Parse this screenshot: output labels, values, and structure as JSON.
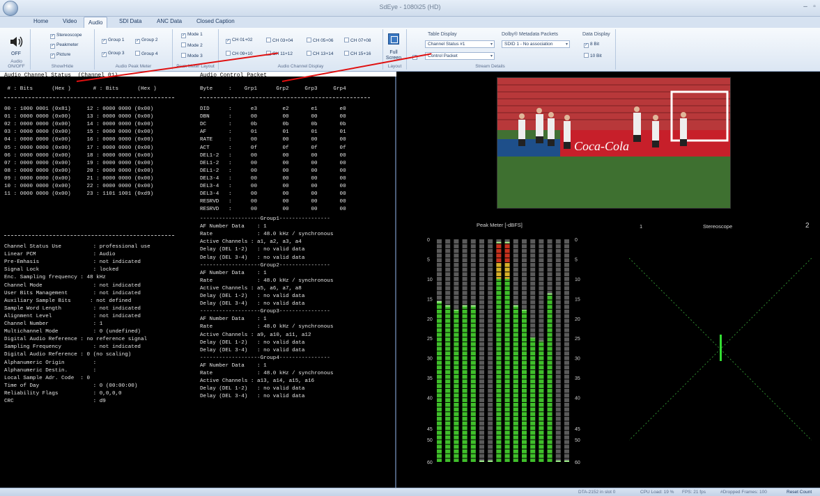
{
  "window": {
    "title": "SdEye - 1080i25  (HD)"
  },
  "tabs": [
    "Home",
    "Video",
    "Audio",
    "SDI Data",
    "ANC Data",
    "Closed Caption"
  ],
  "ribbon": {
    "audio_onoff": {
      "state": "OFF",
      "label": "Audio ON/OFF"
    },
    "show_hide": {
      "label": "Show/Hide",
      "items": [
        "Stereoscope",
        "Peakmeter",
        "Picture"
      ]
    },
    "peak_meter": {
      "label": "Audio Peak Meter",
      "items": [
        "Group 1",
        "Group 2",
        "Group 3",
        "Group 4"
      ]
    },
    "peak_layout": {
      "label": "Peak Meter Layout",
      "items": [
        "Mode 1",
        "Mode 2",
        "Mode 3"
      ]
    },
    "channel_display": {
      "label": "Audio Channel Display",
      "items": [
        "CH 01+02",
        "CH 03+04",
        "CH 05+06",
        "CH 07+08",
        "CH 09+10",
        "CH 11+12",
        "CH 13+14",
        "CH 15+16"
      ]
    },
    "layout": {
      "label": "Layout",
      "full": "Full",
      "screen": "Screen"
    },
    "table_display": {
      "header": "Table Display",
      "select1": "Channel Status #1",
      "select2": "Control Packet"
    },
    "dolby": {
      "header": "Dolby® Metadata Packets",
      "select": "SDID 1 - No association"
    },
    "stream_details": "Stream Details",
    "data_display": {
      "header": "Data Display",
      "items": [
        "8 Bit",
        "10 Bit"
      ]
    }
  },
  "left_header": {
    "status_title": "Audio Channel Status  (Channel 01)",
    "control_title": "Audio Control Packet"
  },
  "cs_header": " # : Bits      (Hex )       # : Bits      (Hex )",
  "cs_rows": [
    "00 : 1000 0001 (0x81)     12 : 0000 0000 (0x00)",
    "01 : 0000 0000 (0x00)     13 : 0000 0000 (0x00)",
    "02 : 0000 0000 (0x00)     14 : 0000 0000 (0x00)",
    "03 : 0000 0000 (0x00)     15 : 0000 0000 (0x00)",
    "04 : 0000 0000 (0x00)     16 : 0000 0000 (0x00)",
    "05 : 0000 0000 (0x00)     17 : 0000 0000 (0x00)",
    "06 : 0000 0000 (0x00)     18 : 0000 0000 (0x00)",
    "07 : 0000 0000 (0x00)     19 : 0000 0000 (0x00)",
    "08 : 0000 0000 (0x00)     20 : 0000 0000 (0x00)",
    "09 : 0000 0000 (0x00)     21 : 0000 0000 (0x00)",
    "10 : 0000 0000 (0x00)     22 : 0000 0000 (0x00)",
    "11 : 0000 0000 (0x00)     23 : 1101 1001 (0xd9)"
  ],
  "cs_info": [
    "Channel Status Use          : professional use",
    "Linear PCM                  : Audio",
    "Pre-Emhasis                 : not indicated",
    "Signal Lock                 : locked",
    "Enc. Sampling frequency : 48 kHz",
    "Channel Mode                : not indicated",
    "User Bits Management        : not indicated",
    "Auxiliary Sample Bits      : not defined",
    "Sample Word Length          : not indicated",
    "Alignment Level             : not indicated",
    "Channel Number              : 1",
    "Multichannel Mode           : 0 (undefined)",
    "Digital Audio Reference : no reference signal",
    "Sampling Frequency          : not indicated",
    "Digital Audio Reference : 0 (no scaling)",
    "Alphanumeric Origin         :",
    "Alphanumeric Destin.        :",
    "Local Sample Adr. Code  : 0",
    "Time of Day                 : 0 (00:00:00)",
    "Reliability Flags           : 0,0,0,0",
    "CRC                         : d9"
  ],
  "acp_header": "Byte     :    Grp1      Grp2     Grp3     Grp4",
  "acp_rows": [
    "DID      :      e3        e2       e1       e0",
    "DBN      :      00        00       00       00",
    "DC       :      0b        0b       0b       0b",
    "AF       :      01        01       01       01",
    "RATE     :      00        00       00       00",
    "ACT      :      0f        0f       0f       0f",
    "DEL1-2   :      00        00       00       00",
    "DEL1-2   :      00        00       00       00",
    "DEL1-2   :      00        00       00       00",
    "DEL3-4   :      00        00       00       00",
    "DEL3-4   :      00        00       00       00",
    "DEL3-4   :      00        00       00       00",
    "RESRVD   :      00        00       00       00",
    "RESRVD   :      00        00       00       00"
  ],
  "acp_groups": [
    "-------------------Group1----------------",
    "AF Number Data    : 1",
    "Rate              : 48.0 kHz / synchronous",
    "Active Channels : a1, a2, a3, a4",
    "Delay (DEL 1-2)   : no valid data",
    "Delay (DEL 3-4)   : no valid data",
    "-------------------Group2----------------",
    "AF Number Data    : 1",
    "Rate              : 48.0 kHz / synchronous",
    "Active Channels : a5, a6, a7, a8",
    "Delay (DEL 1-2)   : no valid data",
    "Delay (DEL 3-4)   : no valid data",
    "-------------------Group3----------------",
    "AF Number Data    : 1",
    "Rate              : 48.0 kHz / synchronous",
    "Active Channels : a9, a10, a11, a12",
    "Delay (DEL 1-2)   : no valid data",
    "Delay (DEL 3-4)   : no valid data",
    "-------------------Group4----------------",
    "AF Number Data    : 1",
    "Rate              : 48.0 kHz / synchronous",
    "Active Channels : a13, a14, a15, a16",
    "Delay (DEL 1-2)   : no valid data",
    "Delay (DEL 3-4)   : no valid data"
  ],
  "peak_meter": {
    "title": "Peak Meter [-dBFS]",
    "scale": [
      "0",
      "5",
      "10",
      "15",
      "20",
      "25",
      "30",
      "35",
      "40",
      "45",
      "50",
      "60"
    ],
    "levels_dbfs": [
      16,
      17,
      18,
      17,
      17,
      60,
      60,
      1,
      1,
      17,
      18,
      25,
      26,
      14,
      60,
      60
    ]
  },
  "stereoscope": {
    "title": "Stereoscope",
    "left": "1",
    "right": "2"
  },
  "statusbar": {
    "device": "DTA-2152 in slot 0",
    "cpu": "CPU Load: 19 %",
    "fps": "FPS: 21 fps",
    "dropped": "#Dropped Frames: 100",
    "reset": "Reset Count"
  }
}
